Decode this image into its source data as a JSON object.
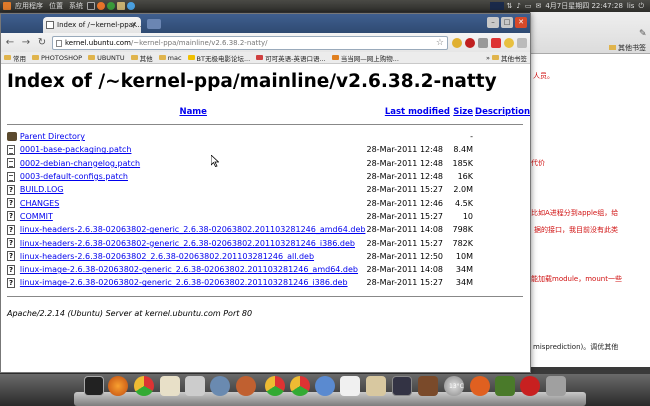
{
  "top_panel": {
    "menus": [
      "应用程序",
      "位置",
      "系统"
    ],
    "clock": "4月7日星期四 22:47:28",
    "user": "lis"
  },
  "browser": {
    "tab_title": "Index of /~kernel-ppa/...",
    "url_host": "kernel.ubuntu.com",
    "url_path": "/~kernel-ppa/mainline/v2.6.38.2-natty/",
    "bookmarks": [
      "常用",
      "PHOTOSHOP",
      "UBUNTU",
      "其他",
      "mac",
      "BT无极电影论坛...",
      "可可英语-英语口语...",
      "当当网—网上购物..."
    ],
    "other_bookmarks": "其他书签"
  },
  "page": {
    "title": "Index of /~kernel-ppa/mainline/v2.6.38.2-natty",
    "columns": {
      "name": "Name",
      "last_modified": "Last modified",
      "size": "Size",
      "description": "Description"
    },
    "parent": {
      "label": "Parent Directory",
      "size": "-"
    },
    "rows": [
      {
        "name": "0001-base-packaging.patch",
        "date": "28-Mar-2011 12:48",
        "size": "8.4M",
        "icon": "text"
      },
      {
        "name": "0002-debian-changelog.patch",
        "date": "28-Mar-2011 12:48",
        "size": "185K",
        "icon": "text"
      },
      {
        "name": "0003-default-configs.patch",
        "date": "28-Mar-2011 12:48",
        "size": "16K",
        "icon": "text"
      },
      {
        "name": "BUILD.LOG",
        "date": "28-Mar-2011 15:27",
        "size": "2.0M",
        "icon": "unknown"
      },
      {
        "name": "CHANGES",
        "date": "28-Mar-2011 12:46",
        "size": "4.5K",
        "icon": "unknown"
      },
      {
        "name": "COMMIT",
        "date": "28-Mar-2011 15:27",
        "size": "10",
        "icon": "unknown"
      },
      {
        "name": "linux-headers-2.6.38-02063802-generic_2.6.38-02063802.201103281246_amd64.deb",
        "date": "28-Mar-2011 14:08",
        "size": "798K",
        "icon": "unknown"
      },
      {
        "name": "linux-headers-2.6.38-02063802-generic_2.6.38-02063802.201103281246_i386.deb",
        "date": "28-Mar-2011 15:27",
        "size": "782K",
        "icon": "unknown"
      },
      {
        "name": "linux-headers-2.6.38-02063802_2.6.38-02063802.201103281246_all.deb",
        "date": "28-Mar-2011 12:50",
        "size": "10M",
        "icon": "unknown"
      },
      {
        "name": "linux-image-2.6.38-02063802-generic_2.6.38-02063802.201103281246_amd64.deb",
        "date": "28-Mar-2011 14:08",
        "size": "34M",
        "icon": "unknown"
      },
      {
        "name": "linux-image-2.6.38-02063802-generic_2.6.38-02063802.201103281246_i386.deb",
        "date": "28-Mar-2011 15:27",
        "size": "34M",
        "icon": "unknown"
      }
    ],
    "address": "Apache/2.2.14 (Ubuntu) Server at kernel.ubuntu.com Port 80"
  },
  "background_window": {
    "texts": [
      "人员。",
      "代价",
      "比如A进程分到apple组，给",
      "据的接口，我目前没有此类",
      "能加载module，mount一些",
      "misprediction)。调优其他"
    ]
  },
  "dock": {
    "temperature": "13°C"
  },
  "colors": {
    "link": "#0000ee",
    "bg_text": "#d01010",
    "tabbar": "#3f5f8f"
  }
}
